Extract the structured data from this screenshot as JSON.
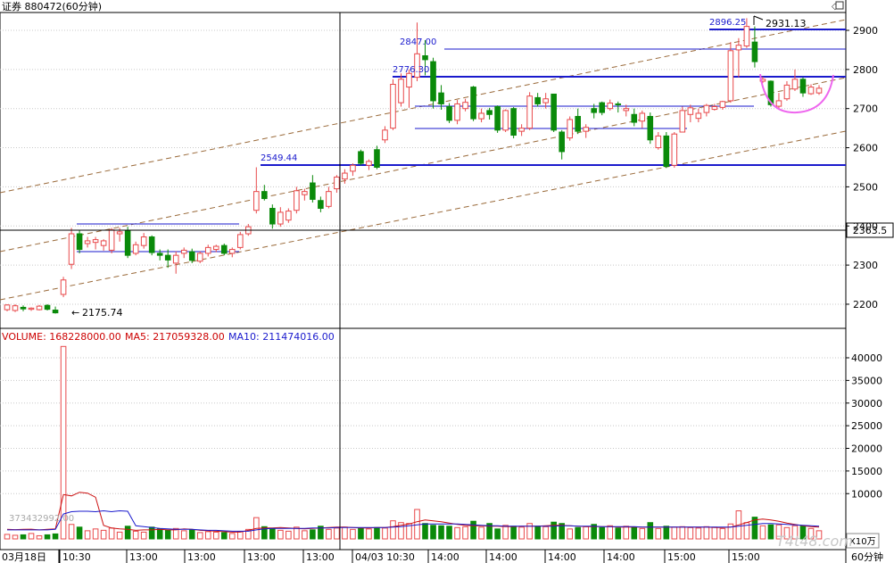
{
  "header": {
    "title": "证券 880472(60分钟)"
  },
  "price_axis": {
    "ticks": [
      "2900",
      "2800",
      "2700",
      "2600",
      "2500",
      "2400",
      "2300",
      "2200"
    ],
    "tick_values": [
      2900,
      2800,
      2700,
      2600,
      2500,
      2400,
      2300,
      2200
    ],
    "crosshair_value_label": "2363.5",
    "crosshair_value": 2363.5
  },
  "volume_axis": {
    "ticks": [
      "40000",
      "35000",
      "30000",
      "25000",
      "20000",
      "15000",
      "10000"
    ],
    "tick_values": [
      40000,
      35000,
      30000,
      25000,
      20000,
      15000,
      10000
    ],
    "unit_label": "X10万"
  },
  "volume_header": {
    "volume": "VOLUME: 168228000.00",
    "ma5": "MA5: 217059328.00",
    "ma10": "MA10: 211474016.00"
  },
  "volume_inline_label": "373432992.00",
  "time_axis": {
    "labels": [
      "03月18日",
      "10:30",
      "13:00",
      "13:00",
      "13:00",
      "13:00",
      "04/03 10:30",
      "14:00",
      "14:00",
      "14:00",
      "14:00",
      "15:00",
      "15:00"
    ],
    "period_label": "60分钟"
  },
  "annotations": {
    "low": "2175.74",
    "level1": "2549.44",
    "level2": "2847.00",
    "level3": "2776.30",
    "level4": "2896.25",
    "high": "2931.13"
  },
  "watermark": "T4t48.com",
  "colors": {
    "up": "#e8484a",
    "down": "#0a8a0a",
    "level_line": "#1a1acd",
    "channel": "#9a6a3a",
    "ma5": "#cc1111",
    "ma10": "#1a1acd",
    "arc": "#ee66ee",
    "axis_text": "#000000",
    "header_red": "#cc0000"
  },
  "chart_data": {
    "type": "candlestick",
    "title": "证券 880472(60分钟)",
    "candles": [
      {
        "o": 2186,
        "h": 2200,
        "l": 2182,
        "c": 2198
      },
      {
        "o": 2184,
        "h": 2200,
        "l": 2180,
        "c": 2196
      },
      {
        "o": 2192,
        "h": 2197,
        "l": 2182,
        "c": 2188
      },
      {
        "o": 2187,
        "h": 2192,
        "l": 2183,
        "c": 2190
      },
      {
        "o": 2186,
        "h": 2198,
        "l": 2184,
        "c": 2195
      },
      {
        "o": 2197,
        "h": 2200,
        "l": 2184,
        "c": 2187
      },
      {
        "o": 2185,
        "h": 2194,
        "l": 2176,
        "c": 2178
      },
      {
        "o": 2225,
        "h": 2270,
        "l": 2218,
        "c": 2262
      },
      {
        "o": 2302,
        "h": 2395,
        "l": 2290,
        "c": 2380
      },
      {
        "o": 2380,
        "h": 2388,
        "l": 2330,
        "c": 2340
      },
      {
        "o": 2355,
        "h": 2372,
        "l": 2345,
        "c": 2362
      },
      {
        "o": 2358,
        "h": 2372,
        "l": 2340,
        "c": 2365
      },
      {
        "o": 2350,
        "h": 2366,
        "l": 2337,
        "c": 2362
      },
      {
        "o": 2338,
        "h": 2395,
        "l": 2330,
        "c": 2390
      },
      {
        "o": 2380,
        "h": 2395,
        "l": 2360,
        "c": 2385
      },
      {
        "o": 2388,
        "h": 2398,
        "l": 2318,
        "c": 2325
      },
      {
        "o": 2330,
        "h": 2360,
        "l": 2325,
        "c": 2352
      },
      {
        "o": 2350,
        "h": 2382,
        "l": 2342,
        "c": 2372
      },
      {
        "o": 2372,
        "h": 2376,
        "l": 2325,
        "c": 2332
      },
      {
        "o": 2330,
        "h": 2340,
        "l": 2312,
        "c": 2325
      },
      {
        "o": 2325,
        "h": 2340,
        "l": 2293,
        "c": 2313
      },
      {
        "o": 2305,
        "h": 2335,
        "l": 2278,
        "c": 2325
      },
      {
        "o": 2330,
        "h": 2345,
        "l": 2318,
        "c": 2338
      },
      {
        "o": 2334,
        "h": 2342,
        "l": 2305,
        "c": 2312
      },
      {
        "o": 2310,
        "h": 2335,
        "l": 2305,
        "c": 2330
      },
      {
        "o": 2330,
        "h": 2352,
        "l": 2322,
        "c": 2345
      },
      {
        "o": 2340,
        "h": 2352,
        "l": 2333,
        "c": 2348
      },
      {
        "o": 2350,
        "h": 2355,
        "l": 2325,
        "c": 2330
      },
      {
        "o": 2330,
        "h": 2345,
        "l": 2320,
        "c": 2340
      },
      {
        "o": 2345,
        "h": 2385,
        "l": 2340,
        "c": 2378
      },
      {
        "o": 2380,
        "h": 2405,
        "l": 2375,
        "c": 2398
      },
      {
        "o": 2440,
        "h": 2550,
        "l": 2432,
        "c": 2488
      },
      {
        "o": 2488,
        "h": 2505,
        "l": 2465,
        "c": 2470
      },
      {
        "o": 2445,
        "h": 2455,
        "l": 2393,
        "c": 2405
      },
      {
        "o": 2405,
        "h": 2448,
        "l": 2398,
        "c": 2435
      },
      {
        "o": 2415,
        "h": 2445,
        "l": 2408,
        "c": 2438
      },
      {
        "o": 2440,
        "h": 2500,
        "l": 2432,
        "c": 2490
      },
      {
        "o": 2480,
        "h": 2495,
        "l": 2465,
        "c": 2488
      },
      {
        "o": 2510,
        "h": 2530,
        "l": 2460,
        "c": 2468
      },
      {
        "o": 2465,
        "h": 2475,
        "l": 2435,
        "c": 2445
      },
      {
        "o": 2450,
        "h": 2500,
        "l": 2445,
        "c": 2488
      },
      {
        "o": 2495,
        "h": 2530,
        "l": 2485,
        "c": 2525
      },
      {
        "o": 2520,
        "h": 2545,
        "l": 2508,
        "c": 2535
      },
      {
        "o": 2540,
        "h": 2560,
        "l": 2528,
        "c": 2555
      },
      {
        "o": 2590,
        "h": 2595,
        "l": 2555,
        "c": 2560
      },
      {
        "o": 2555,
        "h": 2570,
        "l": 2543,
        "c": 2565
      },
      {
        "o": 2595,
        "h": 2605,
        "l": 2545,
        "c": 2550
      },
      {
        "o": 2620,
        "h": 2655,
        "l": 2612,
        "c": 2645
      },
      {
        "o": 2650,
        "h": 2775,
        "l": 2645,
        "c": 2762
      },
      {
        "o": 2715,
        "h": 2790,
        "l": 2705,
        "c": 2775
      },
      {
        "o": 2755,
        "h": 2800,
        "l": 2702,
        "c": 2790
      },
      {
        "o": 2780,
        "h": 2920,
        "l": 2770,
        "c": 2840
      },
      {
        "o": 2835,
        "h": 2875,
        "l": 2785,
        "c": 2825
      },
      {
        "o": 2820,
        "h": 2830,
        "l": 2700,
        "c": 2720
      },
      {
        "o": 2740,
        "h": 2760,
        "l": 2697,
        "c": 2712
      },
      {
        "o": 2705,
        "h": 2714,
        "l": 2663,
        "c": 2670
      },
      {
        "o": 2670,
        "h": 2722,
        "l": 2660,
        "c": 2712
      },
      {
        "o": 2700,
        "h": 2725,
        "l": 2693,
        "c": 2716
      },
      {
        "o": 2755,
        "h": 2758,
        "l": 2668,
        "c": 2674
      },
      {
        "o": 2674,
        "h": 2700,
        "l": 2665,
        "c": 2688
      },
      {
        "o": 2695,
        "h": 2702,
        "l": 2672,
        "c": 2685
      },
      {
        "o": 2705,
        "h": 2708,
        "l": 2638,
        "c": 2645
      },
      {
        "o": 2645,
        "h": 2698,
        "l": 2640,
        "c": 2695
      },
      {
        "o": 2700,
        "h": 2704,
        "l": 2624,
        "c": 2632
      },
      {
        "o": 2642,
        "h": 2660,
        "l": 2630,
        "c": 2650
      },
      {
        "o": 2650,
        "h": 2742,
        "l": 2645,
        "c": 2732
      },
      {
        "o": 2728,
        "h": 2740,
        "l": 2705,
        "c": 2712
      },
      {
        "o": 2715,
        "h": 2740,
        "l": 2700,
        "c": 2725
      },
      {
        "o": 2737,
        "h": 2738,
        "l": 2640,
        "c": 2645
      },
      {
        "o": 2640,
        "h": 2645,
        "l": 2570,
        "c": 2590
      },
      {
        "o": 2625,
        "h": 2680,
        "l": 2618,
        "c": 2672
      },
      {
        "o": 2680,
        "h": 2700,
        "l": 2635,
        "c": 2642
      },
      {
        "o": 2642,
        "h": 2660,
        "l": 2625,
        "c": 2652
      },
      {
        "o": 2700,
        "h": 2712,
        "l": 2675,
        "c": 2690
      },
      {
        "o": 2715,
        "h": 2718,
        "l": 2683,
        "c": 2690
      },
      {
        "o": 2700,
        "h": 2723,
        "l": 2695,
        "c": 2714
      },
      {
        "o": 2712,
        "h": 2718,
        "l": 2690,
        "c": 2710
      },
      {
        "o": 2695,
        "h": 2710,
        "l": 2680,
        "c": 2700
      },
      {
        "o": 2685,
        "h": 2700,
        "l": 2655,
        "c": 2665
      },
      {
        "o": 2668,
        "h": 2695,
        "l": 2650,
        "c": 2688
      },
      {
        "o": 2680,
        "h": 2690,
        "l": 2610,
        "c": 2620
      },
      {
        "o": 2600,
        "h": 2640,
        "l": 2595,
        "c": 2630
      },
      {
        "o": 2630,
        "h": 2640,
        "l": 2548,
        "c": 2552
      },
      {
        "o": 2555,
        "h": 2640,
        "l": 2549,
        "c": 2635
      },
      {
        "o": 2640,
        "h": 2705,
        "l": 2640,
        "c": 2695
      },
      {
        "o": 2685,
        "h": 2710,
        "l": 2665,
        "c": 2702
      },
      {
        "o": 2675,
        "h": 2700,
        "l": 2665,
        "c": 2688
      },
      {
        "o": 2690,
        "h": 2712,
        "l": 2680,
        "c": 2708
      },
      {
        "o": 2698,
        "h": 2712,
        "l": 2695,
        "c": 2705
      },
      {
        "o": 2703,
        "h": 2720,
        "l": 2697,
        "c": 2718
      },
      {
        "o": 2720,
        "h": 2870,
        "l": 2715,
        "c": 2848
      },
      {
        "o": 2850,
        "h": 2880,
        "l": 2780,
        "c": 2862
      },
      {
        "o": 2860,
        "h": 2931,
        "l": 2855,
        "c": 2910
      },
      {
        "o": 2870,
        "h": 2910,
        "l": 2805,
        "c": 2820
      },
      {
        "o": 2770,
        "h": 2782,
        "l": 2765,
        "c": 2775
      },
      {
        "o": 2770,
        "h": 2772,
        "l": 2705,
        "c": 2710
      },
      {
        "o": 2706,
        "h": 2740,
        "l": 2700,
        "c": 2720
      },
      {
        "o": 2725,
        "h": 2770,
        "l": 2720,
        "c": 2760
      },
      {
        "o": 2750,
        "h": 2800,
        "l": 2745,
        "c": 2775
      },
      {
        "o": 2775,
        "h": 2780,
        "l": 2730,
        "c": 2740
      },
      {
        "o": 2738,
        "h": 2762,
        "l": 2735,
        "c": 2755
      },
      {
        "o": 2740,
        "h": 2760,
        "l": 2735,
        "c": 2752
      }
    ],
    "volumes": [
      1000,
      800,
      900,
      1200,
      700,
      900,
      1100,
      42500,
      3200,
      2600,
      1800,
      2200,
      1900,
      2400,
      1500,
      2800,
      1700,
      1500,
      2600,
      2200,
      1900,
      2300,
      1800,
      2000,
      1400,
      1600,
      1500,
      1400,
      1200,
      1600,
      2100,
      4700,
      2700,
      2300,
      1900,
      1700,
      2600,
      1800,
      2000,
      2800,
      2100,
      2400,
      2600,
      2100,
      2300,
      2200,
      2500,
      2400,
      4000,
      3600,
      3400,
      6500,
      3400,
      3000,
      2900,
      2800,
      2500,
      2700,
      3900,
      2600,
      3400,
      2200,
      3000,
      2800,
      2600,
      3400,
      2800,
      2700,
      3700,
      3400,
      2200,
      2500,
      2700,
      3200,
      2500,
      2900,
      2400,
      2800,
      2600,
      2300,
      3600,
      2300,
      2800,
      2600,
      2700,
      2500,
      2400,
      2700,
      2600,
      2300,
      3300,
      6200,
      3600,
      4800,
      2900,
      3100,
      3100,
      2500,
      2900,
      2800,
      2300,
      1800
    ],
    "volume_unit": "X10万",
    "ma5_line_points": [
      2100,
      2050,
      2100,
      2150,
      2000,
      2100,
      2200,
      9800,
      9500,
      10300,
      10100,
      9200,
      3000,
      2400,
      2200,
      2100,
      1900,
      2000,
      2000,
      2100,
      2000,
      2000,
      2200,
      2100,
      1900,
      1800,
      1700,
      1600,
      1500,
      1500,
      1900,
      2300,
      2400,
      2400,
      2500,
      2400,
      2300,
      2200,
      2300,
      2400,
      2500,
      2600,
      2600,
      2500,
      2400,
      2400,
      2500,
      2500,
      2700,
      3000,
      3300,
      3800,
      4200,
      4000,
      3800,
      3500,
      3200,
      3000,
      2900,
      2900,
      2800,
      2800,
      2700,
      2700,
      2800,
      2800,
      2800,
      2900,
      3000,
      3000,
      2900,
      2800,
      2700,
      2700,
      2700,
      2700,
      2600,
      2600,
      2600,
      2600,
      2600,
      2600,
      2600,
      2600,
      2600,
      2600,
      2600,
      2600,
      2500,
      2500,
      2600,
      3100,
      3600,
      4200,
      4400,
      4200,
      3900,
      3500,
      3200,
      2900,
      2700,
      2600
    ],
    "ma10_line_points": [
      2000,
      2000,
      2000,
      2000,
      2000,
      2000,
      2100,
      5500,
      6000,
      6100,
      6100,
      6000,
      6200,
      6000,
      6200,
      6100,
      2900,
      2700,
      2500,
      2300,
      2200,
      2100,
      2100,
      2100,
      2000,
      1900,
      1900,
      1800,
      1700,
      1700,
      1700,
      2000,
      2200,
      2300,
      2300,
      2300,
      2300,
      2300,
      2400,
      2400,
      2400,
      2500,
      2500,
      2500,
      2500,
      2500,
      2500,
      2500,
      2600,
      2700,
      2900,
      3100,
      3300,
      3300,
      3300,
      3300,
      3300,
      3200,
      3100,
      3000,
      2900,
      2900,
      2800,
      2800,
      2800,
      2800,
      2800,
      2800,
      2800,
      2900,
      2900,
      2800,
      2800,
      2800,
      2700,
      2700,
      2700,
      2700,
      2700,
      2600,
      2600,
      2600,
      2600,
      2600,
      2600,
      2600,
      2600,
      2600,
      2600,
      2600,
      2600,
      2800,
      3000,
      3200,
      3400,
      3400,
      3300,
      3200,
      3100,
      3000,
      2900,
      2800
    ],
    "ylim_price": [
      2150,
      2940
    ],
    "ylim_volume": [
      0,
      43000
    ],
    "horizontal_levels": [
      {
        "label": "2175.74",
        "value": 2175.74
      },
      {
        "label": "2549.44",
        "value": 2549.44
      },
      {
        "label": "2847.00",
        "value": 2847.0
      },
      {
        "label": "2776.30",
        "value": 2776.3
      },
      {
        "label": "2896.25",
        "value": 2896.25
      },
      {
        "label": "2931.13",
        "value": 2931.13
      }
    ],
    "xlabel": "",
    "ylabel": ""
  }
}
